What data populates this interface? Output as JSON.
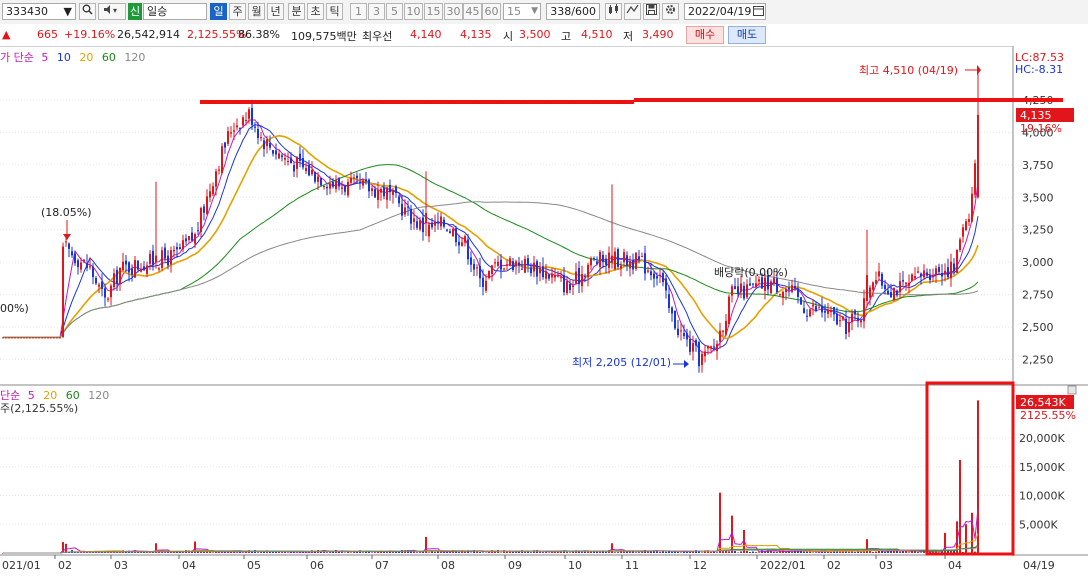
{
  "toolbar": {
    "code": "333430",
    "search_icon": "search-icon",
    "speaker_icon": "speaker-icon",
    "badge": "신",
    "stock_name": "일승",
    "periods": [
      "일",
      "주",
      "월",
      "년",
      "분",
      "초",
      "틱"
    ],
    "selected_period": "일",
    "minute_options": [
      "1",
      "3",
      "5",
      "10",
      "15",
      "30",
      "45",
      "60"
    ],
    "interval_value": "15",
    "count": "338/600",
    "date": "2022/04/19"
  },
  "info": {
    "marker": "▲",
    "change": "665",
    "change_pct": "+19.16%",
    "volume": "26,542,914",
    "volume_pct": "2,125.55%",
    "ratio": "86.38%",
    "amount": "109,575백만",
    "best_bid_label": "최우선",
    "best_ask": "4,140",
    "best_bid": "4,135",
    "open_label": "시",
    "open": "3,500",
    "high_label": "고",
    "high": "4,510",
    "low_label": "저",
    "low": "3,490",
    "buy_label": "매수",
    "sell_label": "매도"
  },
  "price_legend": {
    "prefix": "가 단순",
    "periods": [
      "5",
      "10",
      "20",
      "60",
      "120"
    ],
    "colors": [
      "#cc00cc",
      "#1a36d6",
      "#e6a000",
      "#1a8a1a",
      "#888888"
    ]
  },
  "volume_legend": {
    "prefix": "단순",
    "periods": [
      "5",
      "20",
      "60",
      "120"
    ],
    "colors": [
      "#cc00cc",
      "#e6a000",
      "#1a8a1a",
      "#888888"
    ],
    "current": "주(2,125.55%)"
  },
  "price_axis": {
    "ticks": [
      "4,250",
      "4,000",
      "3,750",
      "3,500",
      "3,250",
      "3,000",
      "2,750",
      "2,500",
      "2,250"
    ],
    "lc": "LC:87.53",
    "hc": "HC:-8.31",
    "current": "4,135",
    "current_pct": "19.16%"
  },
  "volume_axis": {
    "ticks": [
      "20,000K",
      "15,000K",
      "10,000K",
      "5,000K"
    ],
    "current": "26,543K",
    "current_pct": "2125.55%"
  },
  "annotations": {
    "high": "최고 4,510 (04/19)",
    "low": "최저 2,205 (12/01)",
    "pct_left": "(18.05%)",
    "pct_edge": "00%)",
    "dividend": "배당락(0.00%)"
  },
  "x_axis": [
    "021/01",
    "02",
    "03",
    "04",
    "05",
    "06",
    "07",
    "08",
    "09",
    "10",
    "11",
    "12",
    "2022/01",
    "02",
    "03",
    "04",
    "04/19"
  ],
  "colors": {
    "up": "#e0161b",
    "down": "#1a36d6",
    "highlight": "#ee1111"
  }
}
